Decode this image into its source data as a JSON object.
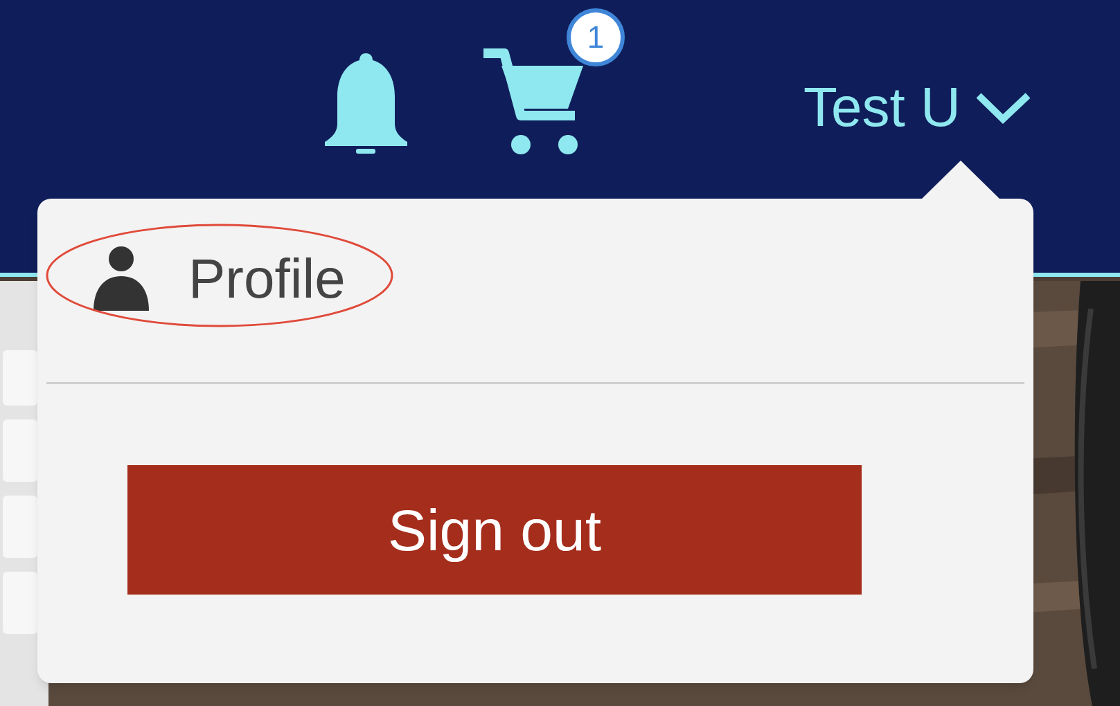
{
  "header": {
    "cart_badge": "1",
    "user_menu": {
      "label": "Test U",
      "expanded": true
    }
  },
  "dropdown": {
    "items": [
      {
        "label": "Profile",
        "highlighted": true
      }
    ],
    "sign_out": "Sign out"
  }
}
